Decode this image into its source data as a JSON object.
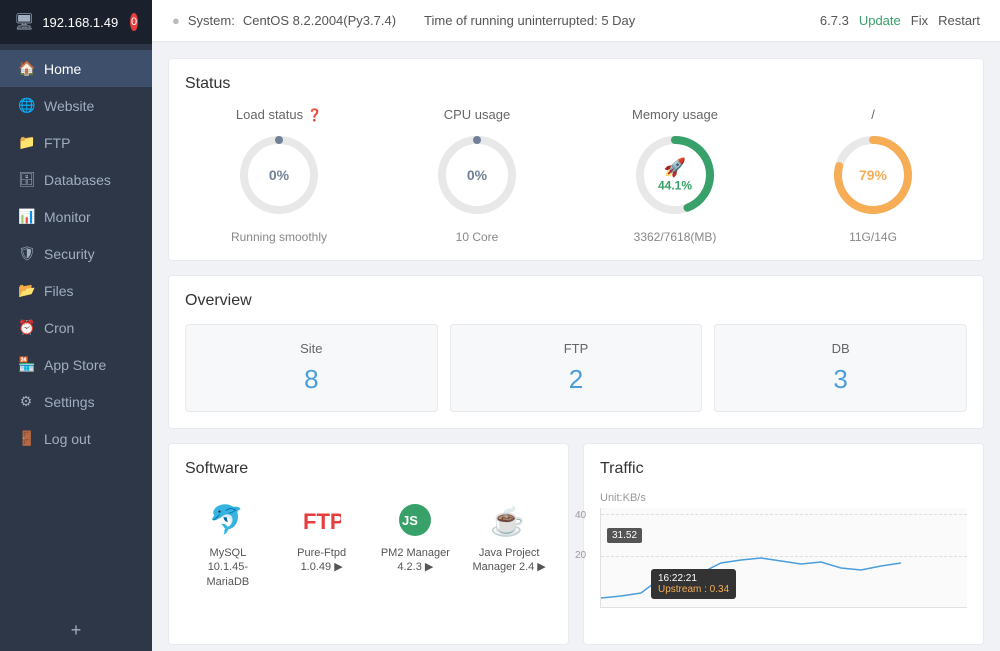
{
  "sidebar": {
    "ip": "192.168.1.49",
    "badge": "0",
    "items": [
      {
        "label": "Home",
        "icon": "🏠",
        "active": true
      },
      {
        "label": "Website",
        "icon": "🌐",
        "active": false
      },
      {
        "label": "FTP",
        "icon": "📁",
        "active": false
      },
      {
        "label": "Databases",
        "icon": "🗄",
        "active": false
      },
      {
        "label": "Monitor",
        "icon": "📊",
        "active": false
      },
      {
        "label": "Security",
        "icon": "🛡",
        "active": false
      },
      {
        "label": "Files",
        "icon": "📂",
        "active": false
      },
      {
        "label": "Cron",
        "icon": "⏰",
        "active": false
      },
      {
        "label": "App Store",
        "icon": "🏪",
        "active": false
      },
      {
        "label": "Settings",
        "icon": "⚙",
        "active": false
      },
      {
        "label": "Log out",
        "icon": "🚪",
        "active": false
      }
    ]
  },
  "topbar": {
    "system_label": "System:",
    "system_value": "CentOS 8.2.2004(Py3.7.4)",
    "uptime_label": "Time of running uninterrupted: 5 Day",
    "version": "6.7.3",
    "update": "Update",
    "fix": "Fix",
    "restart": "Restart"
  },
  "status": {
    "title": "Status",
    "items": [
      {
        "label": "Load status",
        "hint": "?",
        "value": "0%",
        "sub": "Running smoothly",
        "color": "#718096",
        "percent": 0
      },
      {
        "label": "CPU usage",
        "hint": "",
        "value": "0%",
        "sub": "10 Core",
        "color": "#718096",
        "percent": 0
      },
      {
        "label": "Memory usage",
        "hint": "",
        "value": "44.1%",
        "sub": "3362/7618(MB)",
        "color": "#38a169",
        "percent": 44.1
      },
      {
        "label": "/",
        "hint": "",
        "value": "79%",
        "sub": "11G/14G",
        "color": "#f6ad55",
        "percent": 79
      }
    ]
  },
  "overview": {
    "title": "Overview",
    "items": [
      {
        "label": "Site",
        "value": "8"
      },
      {
        "label": "FTP",
        "value": "2"
      },
      {
        "label": "DB",
        "value": "3"
      }
    ]
  },
  "software": {
    "title": "Software",
    "items": [
      {
        "name": "MySQL 10.1.45-\nMariaDB",
        "icon": "mysql"
      },
      {
        "name": "Pure-Ftpd 1.0.49 ▶",
        "icon": "ftpd"
      },
      {
        "name": "PM2 Manager 4.2.3\n▶",
        "icon": "nodejs"
      },
      {
        "name": "Java Project\nManager 2.4 ▶",
        "icon": "java"
      }
    ]
  },
  "traffic": {
    "title": "Traffic",
    "unit": "Unit:KB/s",
    "y_labels": [
      "40",
      "20"
    ],
    "badge_value": "31.52",
    "tooltip_time": "16:22:21",
    "tooltip_label": "Upstream : 0.34"
  }
}
